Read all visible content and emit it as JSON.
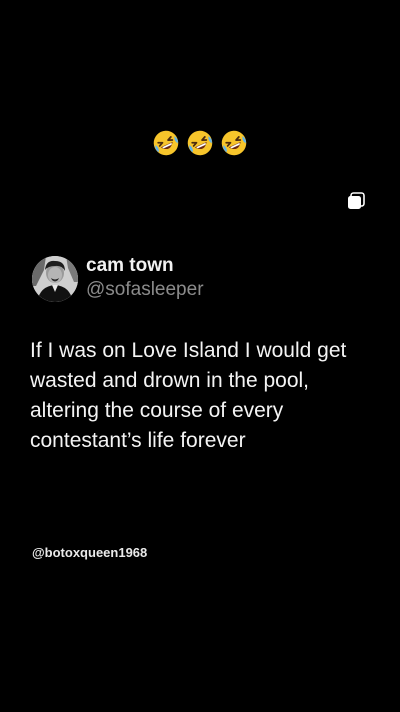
{
  "caption": {
    "emojis": [
      "rolling-on-floor-laughing",
      "rolling-on-floor-laughing",
      "rolling-on-floor-laughing"
    ]
  },
  "tweet": {
    "display_name": "cam town",
    "handle": "@sofasleeper",
    "text": "If I was on Love Island I would get wasted and drown in the pool, altering the course of every contestant’s life forever"
  },
  "watermark": "@botoxqueen1968",
  "colors": {
    "background": "#000000",
    "text": "#f4f4f4",
    "handle": "#8b8b8b",
    "emoji_face": "#f7c52b"
  }
}
